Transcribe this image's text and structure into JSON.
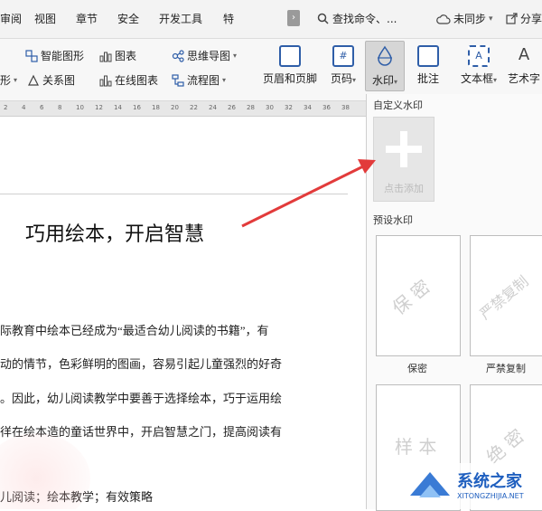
{
  "menu_tabs": [
    "审阅",
    "视图",
    "章节",
    "安全",
    "开发工具",
    "特"
  ],
  "tab_more": "›",
  "search_label": "查找命令、...",
  "sync_label": "未同步",
  "share_label": "分享",
  "ribbon": {
    "smart_shape": "智能图形",
    "chart": "图表",
    "mind_map": "思维导图",
    "shape_partial": "形",
    "relation": "关系图",
    "online_chart": "在线图表",
    "flowchart": "流程图",
    "header_footer": "页眉和页脚",
    "page_number": "页码",
    "watermark": "水印",
    "comment": "批注",
    "textbox": "文本框",
    "wordart": "艺术字"
  },
  "ruler_ticks": [
    "2",
    "4",
    "6",
    "8",
    "10",
    "12",
    "14",
    "16",
    "18",
    "20",
    "22",
    "24",
    "26",
    "28",
    "30",
    "32",
    "34",
    "36",
    "38"
  ],
  "watermark_panel": {
    "custom_title": "自定义水印",
    "add_label": "点击添加",
    "preset_title": "预设水印",
    "presets": [
      {
        "text": "保 密",
        "label": "保密"
      },
      {
        "text": "严禁复制",
        "label": "严禁复制"
      },
      {
        "text": "样 本",
        "label": ""
      },
      {
        "text": "绝 密",
        "label": ""
      }
    ]
  },
  "document": {
    "title": "巧用绘本，开启智慧",
    "lines": [
      "际教育中绘本已经成为“最适合幼儿阅读的书籍”，有",
      "动的情节，色彩鲜明的图画，容易引起儿童强烈的好奇",
      "。因此，幼儿阅读教学中要善于选择绘本，巧于运用绘",
      "徉在绘本造的童话世界中，开启智慧之门，提高阅读有",
      "儿阅读；绘本教学；有效策略"
    ]
  },
  "logo": {
    "name": "系统之家",
    "url": "XITONGZHIJIA.NET"
  },
  "colors": {
    "arrow": "#e23b3b",
    "accent_blue": "#2f5ea8"
  }
}
